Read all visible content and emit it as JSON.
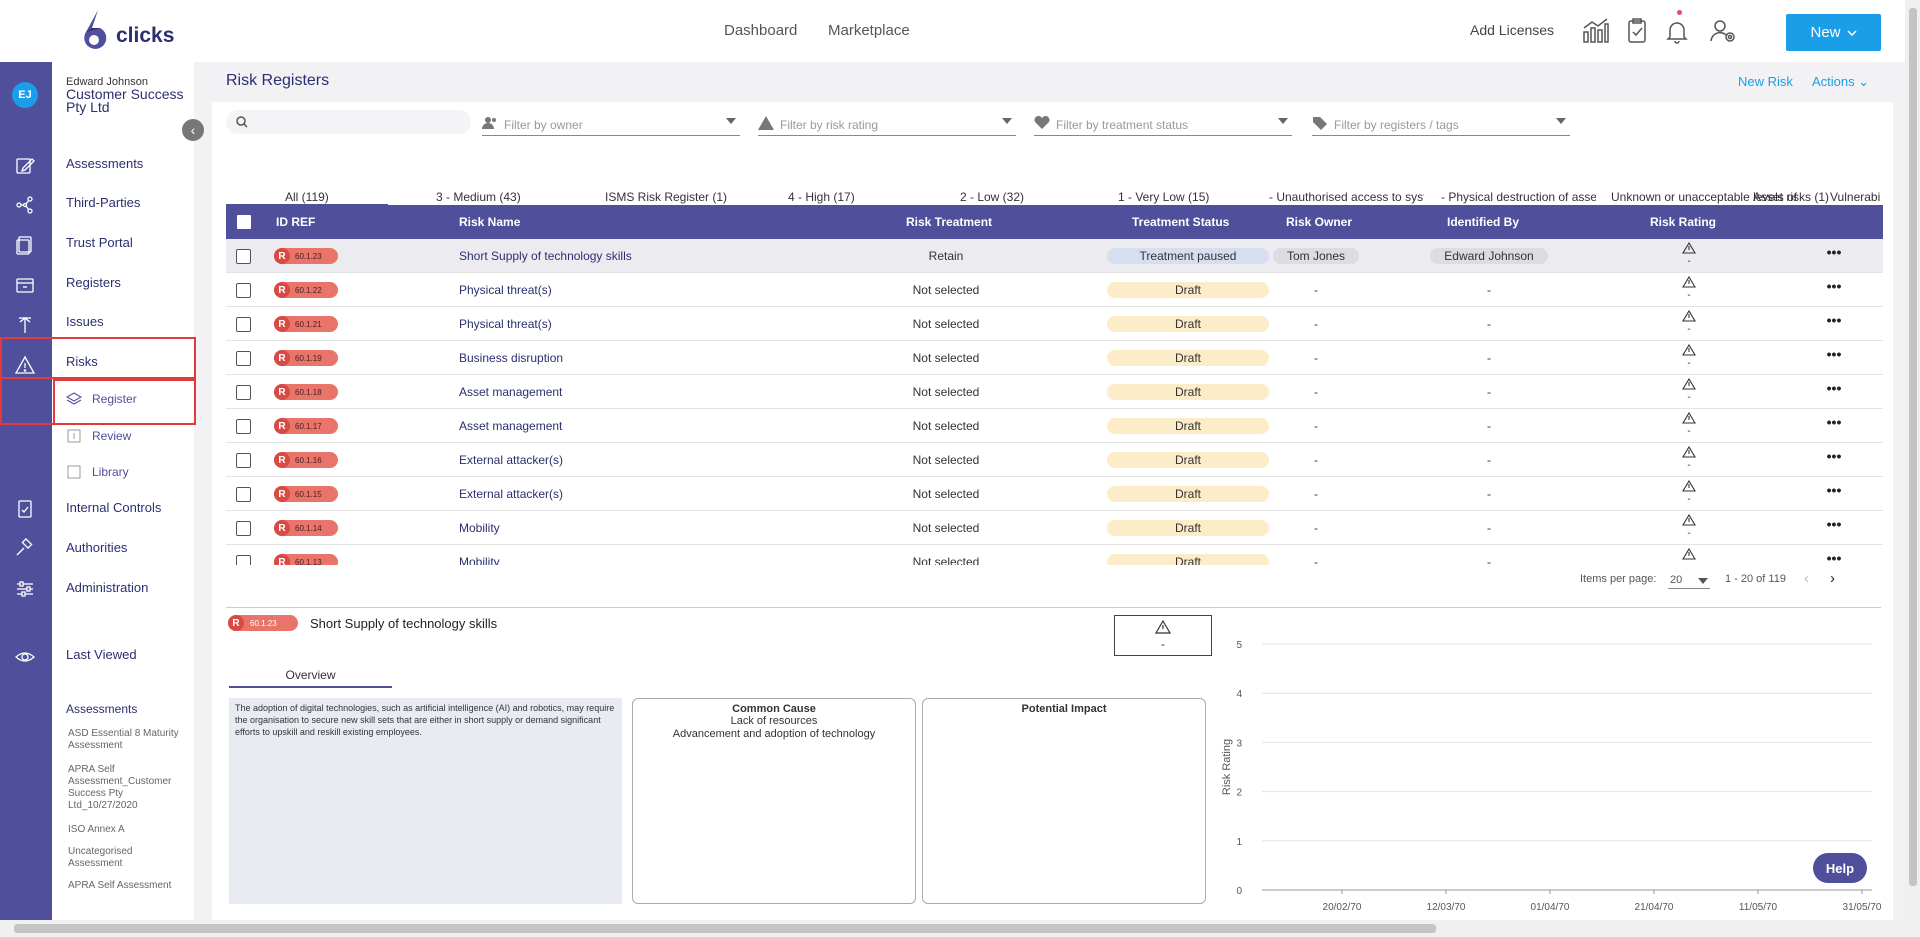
{
  "header": {
    "logo_text": "clicks",
    "nav": [
      "Dashboard",
      "Marketplace"
    ],
    "add_licenses": "Add Licenses",
    "new_button": "New",
    "icons": [
      "chart-icon",
      "clipboard-check-icon",
      "bell-icon",
      "user-settings-icon"
    ]
  },
  "user": {
    "initials": "EJ",
    "name": "Edward Johnson",
    "org": "Customer Success Pty Ltd"
  },
  "sidebar": {
    "items": [
      {
        "label": "Assessments"
      },
      {
        "label": "Third-Parties"
      },
      {
        "label": "Trust Portal"
      },
      {
        "label": "Registers"
      },
      {
        "label": "Issues"
      },
      {
        "label": "Risks"
      }
    ],
    "risk_sub": [
      {
        "label": "Register"
      },
      {
        "label": "Review"
      },
      {
        "label": "Library"
      }
    ],
    "lower_items": [
      {
        "label": "Internal Controls"
      },
      {
        "label": "Authorities"
      },
      {
        "label": "Administration"
      }
    ],
    "last_viewed": "Last Viewed",
    "lv_heading": "Assessments",
    "lv_items": [
      "ASD Essential 8 Maturity Assessment",
      "APRA Self Assessment_Customer Success Pty Ltd_10/27/2020",
      "ISO Annex A",
      "Uncategorised Assessment",
      "APRA Self Assessment"
    ]
  },
  "page": {
    "title": "Risk Registers",
    "new_risk": "New Risk",
    "actions": "Actions"
  },
  "filters": {
    "owner": "Filter by owner",
    "rating": "Filter by risk rating",
    "treatment": "Filter by treatment status",
    "tags": "Filter by registers / tags"
  },
  "tabs": [
    "All (119)",
    "3 - Medium (43)",
    "ISMS Risk Register (1)",
    "4 - High (17)",
    "2 - Low (32)",
    "1 - Very Low (15)",
    "- Unauthorised access to syste",
    "- Physical destruction of asset",
    "Unknown or unacceptable levels of",
    "Asset risks (1)",
    "Vulnerabilities a"
  ],
  "table": {
    "headers": [
      "ID REF",
      "Risk Name",
      "Risk Treatment",
      "Treatment Status",
      "Risk Owner",
      "Identified By",
      "Risk Rating"
    ],
    "rows": [
      {
        "id": "60.1.23",
        "name": "Short Supply of technology skills",
        "treatment": "Retain",
        "status": "Treatment paused",
        "owner": "Tom Jones",
        "identified": "Edward Johnson",
        "rating": "-"
      },
      {
        "id": "60.1.22",
        "name": "Physical threat(s)",
        "treatment": "Not selected",
        "status": "Draft",
        "owner": "-",
        "identified": "-",
        "rating": "-"
      },
      {
        "id": "60.1.21",
        "name": "Physical threat(s)",
        "treatment": "Not selected",
        "status": "Draft",
        "owner": "-",
        "identified": "-",
        "rating": "-"
      },
      {
        "id": "60.1.19",
        "name": "Business disruption",
        "treatment": "Not selected",
        "status": "Draft",
        "owner": "-",
        "identified": "-",
        "rating": "-"
      },
      {
        "id": "60.1.18",
        "name": "Asset management",
        "treatment": "Not selected",
        "status": "Draft",
        "owner": "-",
        "identified": "-",
        "rating": "-"
      },
      {
        "id": "60.1.17",
        "name": "Asset management",
        "treatment": "Not selected",
        "status": "Draft",
        "owner": "-",
        "identified": "-",
        "rating": "-"
      },
      {
        "id": "60.1.16",
        "name": "External attacker(s)",
        "treatment": "Not selected",
        "status": "Draft",
        "owner": "-",
        "identified": "-",
        "rating": "-"
      },
      {
        "id": "60.1.15",
        "name": "External attacker(s)",
        "treatment": "Not selected",
        "status": "Draft",
        "owner": "-",
        "identified": "-",
        "rating": "-"
      },
      {
        "id": "60.1.14",
        "name": "Mobility",
        "treatment": "Not selected",
        "status": "Draft",
        "owner": "-",
        "identified": "-",
        "rating": "-"
      },
      {
        "id": "60.1.13",
        "name": "Mobility",
        "treatment": "Not selected",
        "status": "Draft",
        "owner": "-",
        "identified": "-",
        "rating": "-"
      }
    ]
  },
  "pager": {
    "label": "Items per page:",
    "per_page": "20",
    "range": "1 - 20 of 119"
  },
  "detail": {
    "id": "60.1.23",
    "title": "Short Supply of technology skills",
    "rating": "-",
    "tab": "Overview",
    "description": "The adoption of digital technologies, such as artificial intelligence (AI) and robotics, may require the organisation to secure new skill sets that are either in short supply or demand significant efforts to upskill and reskill existing employees.",
    "common_cause_title": "Common Cause",
    "common_causes": [
      "Lack of resources",
      "Advancement and adoption of technology"
    ],
    "impact_title": "Potential Impact"
  },
  "chart_data": {
    "type": "line",
    "ylabel": "Risk Rating",
    "ylim": [
      0,
      5
    ],
    "yticks": [
      "0",
      "1",
      "2",
      "3",
      "4",
      "5"
    ],
    "categories": [
      "20/02/70",
      "12/03/70",
      "01/04/70",
      "21/04/70",
      "11/05/70",
      "31/05/70"
    ],
    "series": []
  },
  "help": "Help",
  "colors": {
    "brand": "#4f4f9c",
    "accent": "#1a9ee8",
    "draft": "#fdecc8",
    "paused": "#d6dff0",
    "risk_pill": "#e8746a"
  }
}
